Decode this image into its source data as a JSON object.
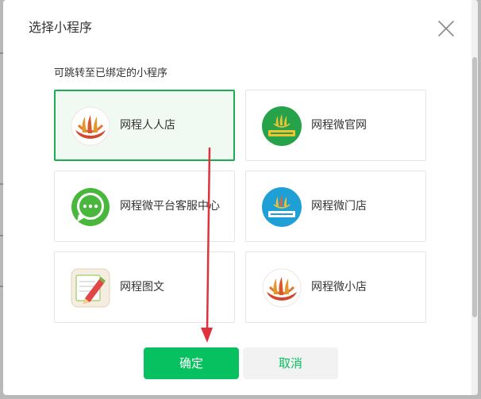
{
  "dialog": {
    "title": "选择小程序",
    "section_label": "可跳转至已绑定的小程序",
    "confirm_label": "确定",
    "cancel_label": "取消"
  },
  "mini_programs": [
    {
      "name": "网程人人店",
      "icon": "flame-logo-icon",
      "selected": true
    },
    {
      "name": "网程微官网",
      "icon": "green-badge-logo-icon",
      "selected": false
    },
    {
      "name": "网程微平台客服中心",
      "icon": "chat-bubble-icon",
      "selected": false
    },
    {
      "name": "网程微门店",
      "icon": "blue-badge-logo-icon",
      "selected": false
    },
    {
      "name": "网程图文",
      "icon": "pencil-note-icon",
      "selected": false
    },
    {
      "name": "网程微小店",
      "icon": "flame-logo-icon",
      "selected": false
    }
  ],
  "colors": {
    "accent": "#07c160",
    "selected_border": "#1aad52",
    "annotation_arrow": "#e0323c"
  }
}
